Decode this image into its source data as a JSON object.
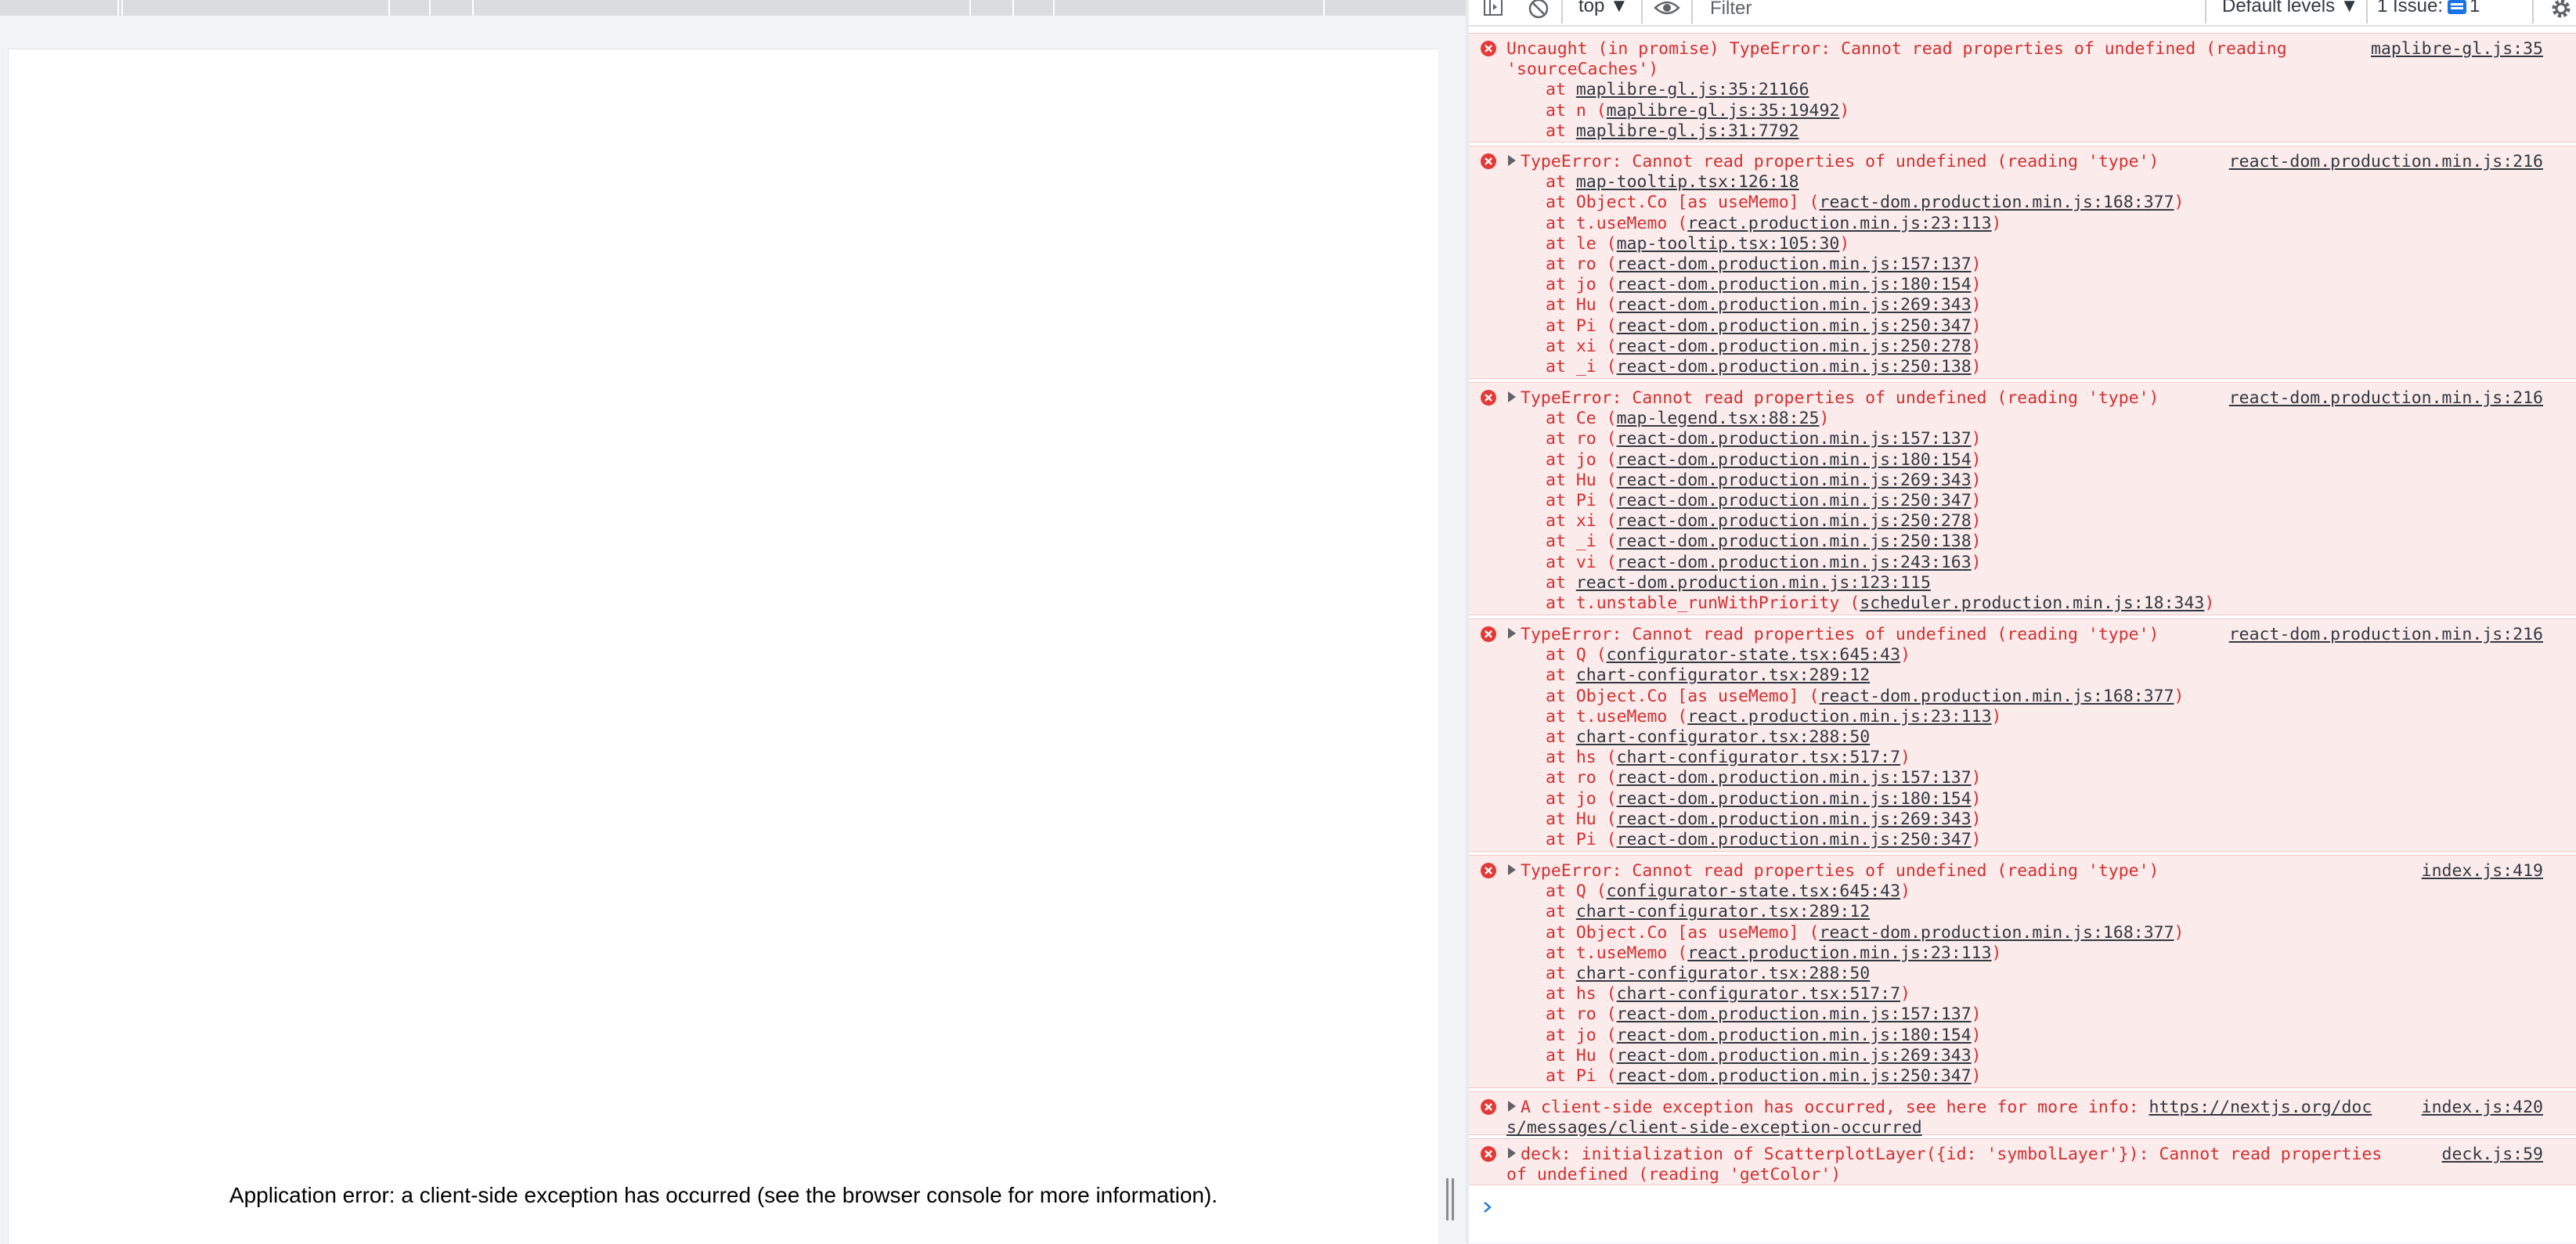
{
  "page": {
    "error_text": "Application error: a client-side exception has occurred (see the browser console for more information)."
  },
  "toolbar": {
    "context": "top ▼",
    "filter_placeholder": "Filter",
    "levels": "Default levels ▼",
    "issues_label": "1 Issue:",
    "issues_count": "1"
  },
  "messages": [
    {
      "head": "Uncaught (in promise) TypeError: Cannot read properties of undefined (reading",
      "head2": "'sourceCaches')",
      "source": "maplibre-gl.js:35",
      "frames": [
        {
          "pre": "at ",
          "link": "maplibre-gl.js:35:21166",
          "post": ""
        },
        {
          "pre": "at n (",
          "link": "maplibre-gl.js:35:19492",
          "post": ")"
        },
        {
          "pre": "at ",
          "link": "maplibre-gl.js:31:7792",
          "post": ""
        }
      ]
    },
    {
      "head": "TypeError: Cannot read properties of undefined (reading 'type')",
      "source": "react-dom.production.min.js:216",
      "frames": [
        {
          "pre": "at ",
          "link": "map-tooltip.tsx:126:18",
          "post": ""
        },
        {
          "pre": "at Object.Co [as useMemo] (",
          "link": "react-dom.production.min.js:168:377",
          "post": ")"
        },
        {
          "pre": "at t.useMemo (",
          "link": "react.production.min.js:23:113",
          "post": ")"
        },
        {
          "pre": "at le (",
          "link": "map-tooltip.tsx:105:30",
          "post": ")"
        },
        {
          "pre": "at ro (",
          "link": "react-dom.production.min.js:157:137",
          "post": ")"
        },
        {
          "pre": "at jo (",
          "link": "react-dom.production.min.js:180:154",
          "post": ")"
        },
        {
          "pre": "at Hu (",
          "link": "react-dom.production.min.js:269:343",
          "post": ")"
        },
        {
          "pre": "at Pi (",
          "link": "react-dom.production.min.js:250:347",
          "post": ")"
        },
        {
          "pre": "at xi (",
          "link": "react-dom.production.min.js:250:278",
          "post": ")"
        },
        {
          "pre": "at _i (",
          "link": "react-dom.production.min.js:250:138",
          "post": ")"
        }
      ]
    },
    {
      "head": "TypeError: Cannot read properties of undefined (reading 'type')",
      "source": "react-dom.production.min.js:216",
      "frames": [
        {
          "pre": "at Ce (",
          "link": "map-legend.tsx:88:25",
          "post": ")"
        },
        {
          "pre": "at ro (",
          "link": "react-dom.production.min.js:157:137",
          "post": ")"
        },
        {
          "pre": "at jo (",
          "link": "react-dom.production.min.js:180:154",
          "post": ")"
        },
        {
          "pre": "at Hu (",
          "link": "react-dom.production.min.js:269:343",
          "post": ")"
        },
        {
          "pre": "at Pi (",
          "link": "react-dom.production.min.js:250:347",
          "post": ")"
        },
        {
          "pre": "at xi (",
          "link": "react-dom.production.min.js:250:278",
          "post": ")"
        },
        {
          "pre": "at _i (",
          "link": "react-dom.production.min.js:250:138",
          "post": ")"
        },
        {
          "pre": "at vi (",
          "link": "react-dom.production.min.js:243:163",
          "post": ")"
        },
        {
          "pre": "at ",
          "link": "react-dom.production.min.js:123:115",
          "post": ""
        },
        {
          "pre": "at t.unstable_runWithPriority (",
          "link": "scheduler.production.min.js:18:343",
          "post": ")"
        }
      ]
    },
    {
      "head": "TypeError: Cannot read properties of undefined (reading 'type')",
      "source": "react-dom.production.min.js:216",
      "frames": [
        {
          "pre": "at Q (",
          "link": "configurator-state.tsx:645:43",
          "post": ")"
        },
        {
          "pre": "at ",
          "link": "chart-configurator.tsx:289:12",
          "post": ""
        },
        {
          "pre": "at Object.Co [as useMemo] (",
          "link": "react-dom.production.min.js:168:377",
          "post": ")"
        },
        {
          "pre": "at t.useMemo (",
          "link": "react.production.min.js:23:113",
          "post": ")"
        },
        {
          "pre": "at ",
          "link": "chart-configurator.tsx:288:50",
          "post": ""
        },
        {
          "pre": "at hs (",
          "link": "chart-configurator.tsx:517:7",
          "post": ")"
        },
        {
          "pre": "at ro (",
          "link": "react-dom.production.min.js:157:137",
          "post": ")"
        },
        {
          "pre": "at jo (",
          "link": "react-dom.production.min.js:180:154",
          "post": ")"
        },
        {
          "pre": "at Hu (",
          "link": "react-dom.production.min.js:269:343",
          "post": ")"
        },
        {
          "pre": "at Pi (",
          "link": "react-dom.production.min.js:250:347",
          "post": ")"
        }
      ]
    },
    {
      "head": "TypeError: Cannot read properties of undefined (reading 'type')",
      "source": "index.js:419",
      "frames": [
        {
          "pre": "at Q (",
          "link": "configurator-state.tsx:645:43",
          "post": ")"
        },
        {
          "pre": "at ",
          "link": "chart-configurator.tsx:289:12",
          "post": ""
        },
        {
          "pre": "at Object.Co [as useMemo] (",
          "link": "react-dom.production.min.js:168:377",
          "post": ")"
        },
        {
          "pre": "at t.useMemo (",
          "link": "react.production.min.js:23:113",
          "post": ")"
        },
        {
          "pre": "at ",
          "link": "chart-configurator.tsx:288:50",
          "post": ""
        },
        {
          "pre": "at hs (",
          "link": "chart-configurator.tsx:517:7",
          "post": ")"
        },
        {
          "pre": "at ro (",
          "link": "react-dom.production.min.js:157:137",
          "post": ")"
        },
        {
          "pre": "at jo (",
          "link": "react-dom.production.min.js:180:154",
          "post": ")"
        },
        {
          "pre": "at Hu (",
          "link": "react-dom.production.min.js:269:343",
          "post": ")"
        },
        {
          "pre": "at Pi (",
          "link": "react-dom.production.min.js:250:347",
          "post": ")"
        }
      ]
    },
    {
      "head": "A client-side exception has occurred, see here for more info: ",
      "head_link": "https://nextjs.org/doc",
      "head2_link": "s/messages/client-side-exception-occurred",
      "source": "index.js:420"
    },
    {
      "head": "deck: initialization of ScatterplotLayer({id: 'symbolLayer'}): Cannot read properties",
      "head2": "of undefined (reading 'getColor')",
      "source": "deck.js:59"
    }
  ]
}
